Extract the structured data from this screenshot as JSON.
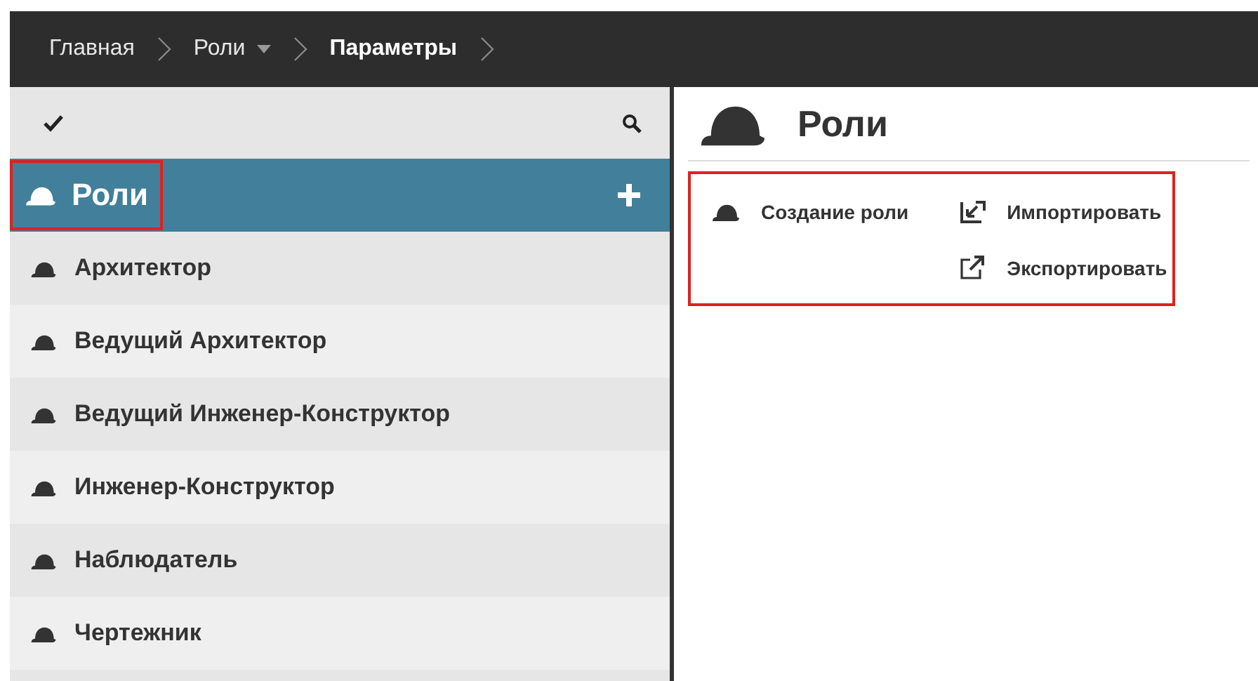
{
  "breadcrumb": [
    {
      "label": "Главная",
      "current": false,
      "dropdown": false
    },
    {
      "label": "Роли",
      "current": false,
      "dropdown": true
    },
    {
      "label": "Параметры",
      "current": true,
      "dropdown": false
    }
  ],
  "sidebar": {
    "header": {
      "title": "Роли",
      "highlighted": true
    },
    "items": [
      {
        "label": "Архитектор"
      },
      {
        "label": "Ведущий Архитектор"
      },
      {
        "label": "Ведущий Инженер-Конструктор"
      },
      {
        "label": "Инженер-Конструктор"
      },
      {
        "label": "Наблюдатель"
      },
      {
        "label": "Чертежник"
      }
    ]
  },
  "main": {
    "title": "Роли",
    "actions_highlighted": true,
    "actions": [
      {
        "label": "Создание роли",
        "kind": "create"
      },
      {
        "label": "Импортировать",
        "kind": "import"
      },
      {
        "label": "Экспортировать",
        "kind": "export"
      }
    ]
  }
}
